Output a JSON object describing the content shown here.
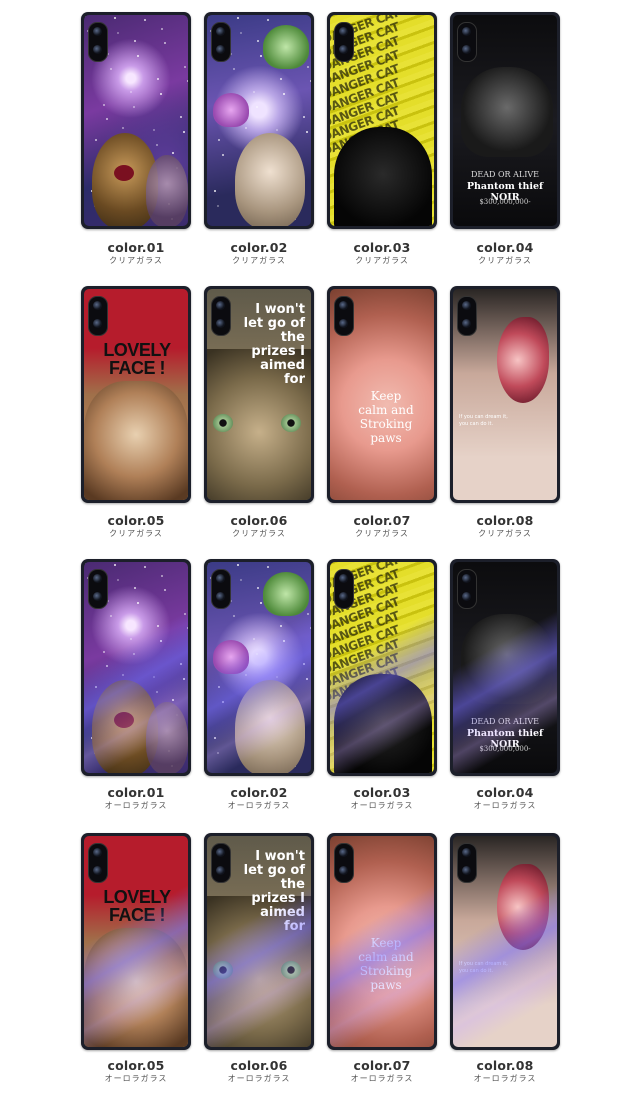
{
  "items": [
    {
      "label": "color.01",
      "sub": "クリアガラス",
      "theme": "galaxy"
    },
    {
      "label": "color.02",
      "sub": "クリアガラス",
      "theme": "galaxy2"
    },
    {
      "label": "color.03",
      "sub": "クリアガラス",
      "theme": "danger"
    },
    {
      "label": "color.04",
      "sub": "クリアガラス",
      "theme": "dark"
    },
    {
      "label": "color.05",
      "sub": "クリアガラス",
      "theme": "lovely"
    },
    {
      "label": "color.06",
      "sub": "クリアガラス",
      "theme": "tabby"
    },
    {
      "label": "color.07",
      "sub": "クリアガラス",
      "theme": "paw"
    },
    {
      "label": "color.08",
      "sub": "クリアガラス",
      "theme": "yawn"
    },
    {
      "label": "color.01",
      "sub": "オーロラガラス",
      "theme": "galaxy"
    },
    {
      "label": "color.02",
      "sub": "オーロラガラス",
      "theme": "galaxy2"
    },
    {
      "label": "color.03",
      "sub": "オーロラガラス",
      "theme": "danger"
    },
    {
      "label": "color.04",
      "sub": "オーロラガラス",
      "theme": "dark"
    },
    {
      "label": "color.05",
      "sub": "オーロラガラス",
      "theme": "lovely"
    },
    {
      "label": "color.06",
      "sub": "オーロラガラス",
      "theme": "tabby"
    },
    {
      "label": "color.07",
      "sub": "オーロラガラス",
      "theme": "paw"
    },
    {
      "label": "color.08",
      "sub": "オーロラガラス",
      "theme": "yawn"
    }
  ],
  "art": {
    "danger_word": "DANGER CAT",
    "dead_or_alive": "DEAD OR ALIVE",
    "phantom": "Phantom thief NOIR",
    "bounty": "$300,000,000-",
    "lovely": "LOVELY FACE !",
    "prizes": "I won't let go of the prizes I aimed for",
    "keep": "Keep calm and Stroking paws",
    "dream": "If you can dream it, you can do it."
  }
}
